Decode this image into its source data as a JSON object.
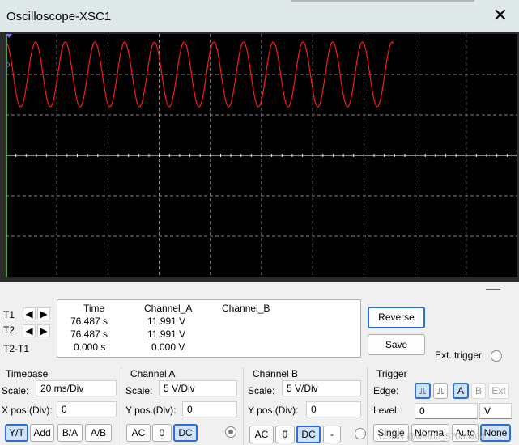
{
  "window": {
    "title": "Oscilloscope-XSC1",
    "close_icon": "close-icon"
  },
  "measurements": {
    "headers": {
      "time": "Time",
      "channel_a": "Channel_A",
      "channel_b": "Channel_B"
    },
    "t1": {
      "label": "T1",
      "time": "76.487 s",
      "a": "11.991 V",
      "b": ""
    },
    "t2": {
      "label": "T2",
      "time": "76.487 s",
      "a": "11.991 V",
      "b": ""
    },
    "t2t1": {
      "label": "T2-T1",
      "time": "0.000 s",
      "a": "0.000 V",
      "b": ""
    }
  },
  "buttons": {
    "reverse": "Reverse",
    "save": "Save",
    "ext_trigger": "Ext. trigger"
  },
  "timebase": {
    "title": "Timebase",
    "scale_label": "Scale:",
    "scale_value": "20 ms/Div",
    "xpos_label": "X pos.(Div):",
    "xpos_value": "0",
    "modes": [
      "Y/T",
      "Add",
      "B/A",
      "A/B"
    ],
    "selected_mode": "Y/T"
  },
  "channel_a": {
    "title": "Channel A",
    "scale_label": "Scale:",
    "scale_value": "5  V/Div",
    "ypos_label": "Y pos.(Div):",
    "ypos_value": "0",
    "coupling": [
      "AC",
      "0",
      "DC"
    ],
    "selected_coupling": "DC"
  },
  "channel_b": {
    "title": "Channel B",
    "scale_label": "Scale:",
    "scale_value": "5  V/Div",
    "ypos_label": "Y pos.(Div):",
    "ypos_value": "0",
    "coupling": [
      "AC",
      "0",
      "DC",
      "-"
    ],
    "selected_coupling": "DC"
  },
  "trigger": {
    "title": "Trigger",
    "edge_label": "Edge:",
    "level_label": "Level:",
    "level_value": "0",
    "level_unit": "V",
    "sources": [
      "A",
      "B",
      "Ext"
    ],
    "selected_source": "A",
    "types": [
      "Single",
      "Normal",
      "Auto",
      "None"
    ],
    "selected_type": "None"
  },
  "watermark": "CSDN @weixin_57086404",
  "colors": {
    "trace": "#ff1a1a",
    "grid": "#b0b0b0",
    "screen_bg": "#000000",
    "cursor1": "#8a6cff",
    "cursor2": "#66d466",
    "accent": "#2b6fd5"
  },
  "waveform": {
    "cycles": 13,
    "peak_div": 2.8,
    "trough_div": 1.2,
    "span_div": 7.55
  }
}
